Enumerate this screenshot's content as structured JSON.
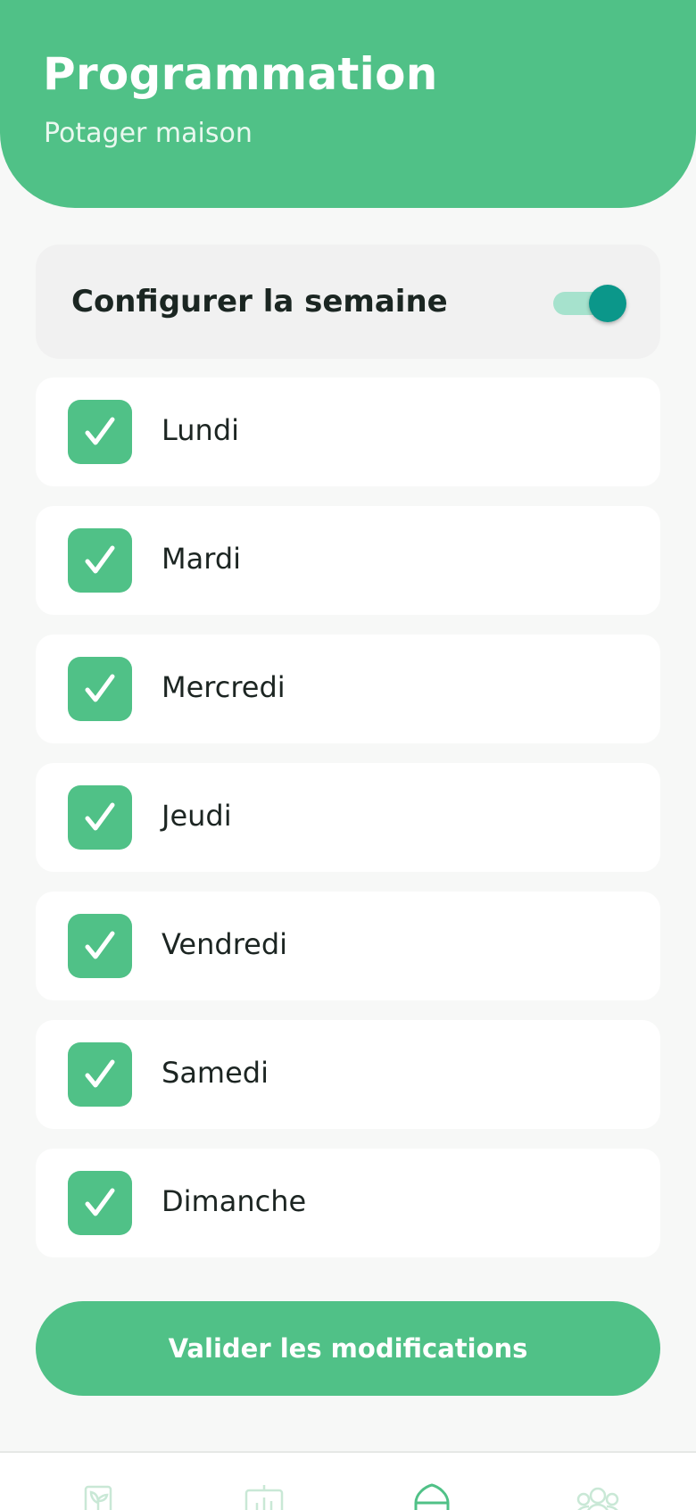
{
  "header": {
    "title": "Programmation",
    "subtitle": "Potager maison"
  },
  "week_config": {
    "label": "Configurer la semaine",
    "enabled": true
  },
  "days": [
    {
      "label": "Lundi",
      "checked": true
    },
    {
      "label": "Mardi",
      "checked": true
    },
    {
      "label": "Mercredi",
      "checked": true
    },
    {
      "label": "Jeudi",
      "checked": true
    },
    {
      "label": "Vendredi",
      "checked": true
    },
    {
      "label": "Samedi",
      "checked": true
    },
    {
      "label": "Dimanche",
      "checked": true
    }
  ],
  "validate_button": {
    "label": "Valider les modifications"
  },
  "bottom_nav": {
    "items": [
      {
        "icon": "plant-icon",
        "active": false
      },
      {
        "icon": "stats-board-icon",
        "active": false
      },
      {
        "icon": "home-icon",
        "active": true
      },
      {
        "icon": "users-icon",
        "active": false
      }
    ]
  },
  "colors": {
    "primary": "#50c187",
    "toggle_knob": "#0b978a",
    "toggle_track": "#a6e2cd",
    "text_dark": "#1c2522"
  }
}
